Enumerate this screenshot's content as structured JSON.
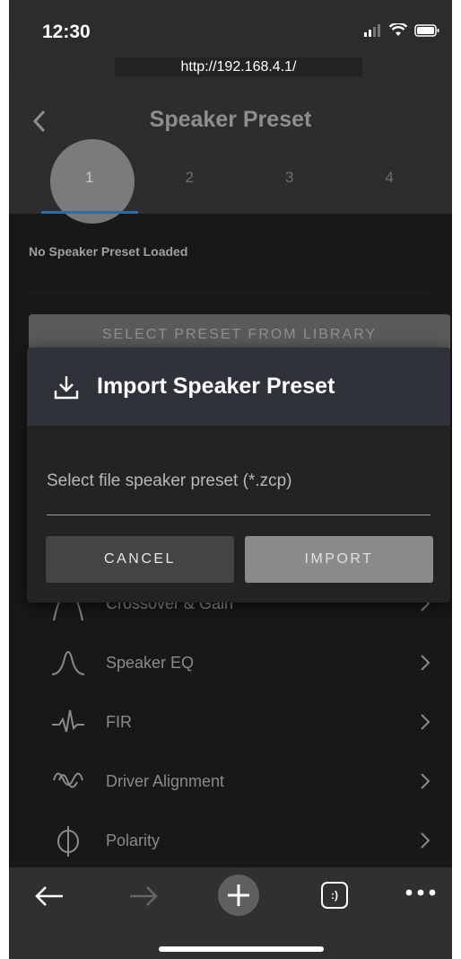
{
  "statusbar": {
    "time": "12:30",
    "url": "http://192.168.4.1/"
  },
  "header": {
    "title": "Speaker Preset",
    "tabs": [
      "1",
      "2",
      "3",
      "4"
    ],
    "active_tab": "1"
  },
  "preset": {
    "status": "No Speaker Preset Loaded",
    "select_library_label": "SELECT PRESET FROM LIBRARY"
  },
  "modal": {
    "title": "Import Speaker Preset",
    "file_placeholder": "Select file speaker preset (*.zcp)",
    "cancel_label": "CANCEL",
    "import_label": "IMPORT"
  },
  "menu": [
    {
      "label": "Crossover & Gain",
      "icon": "crossover-icon"
    },
    {
      "label": "Speaker EQ",
      "icon": "eq-curve-icon"
    },
    {
      "label": "FIR",
      "icon": "fir-icon"
    },
    {
      "label": "Driver Alignment",
      "icon": "alignment-icon"
    },
    {
      "label": "Polarity",
      "icon": "polarity-icon"
    }
  ],
  "toolbar": {
    "tabs_label": ":)"
  },
  "colors": {
    "accent_tab": "#2c6ba6",
    "modal_header": "#30323a",
    "background": "#181818"
  }
}
